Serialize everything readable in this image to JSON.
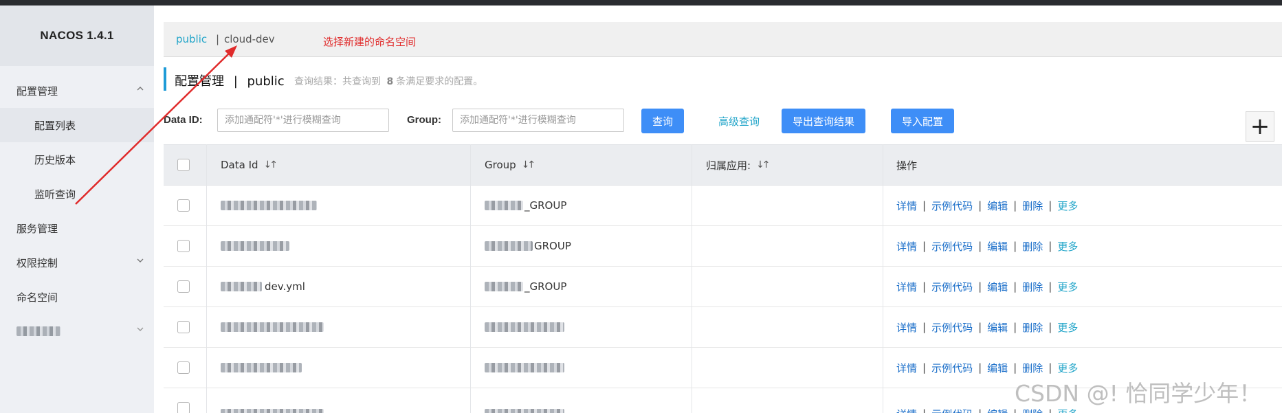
{
  "app": {
    "title": "NACOS 1.4.1"
  },
  "sidebar": {
    "items": [
      {
        "label": "配置管理",
        "chevron": "^"
      },
      {
        "label": "配置列表"
      },
      {
        "label": "历史版本"
      },
      {
        "label": "监听查询"
      },
      {
        "label": "服务管理"
      },
      {
        "label": "权限控制",
        "chevron": "v"
      },
      {
        "label": "命名空间"
      }
    ]
  },
  "namespace_bar": {
    "active": "public",
    "separator": "|",
    "other": "cloud-dev"
  },
  "annotation": {
    "text": "选择新建的命名空间",
    "color": "#e02b2b"
  },
  "page": {
    "title": "配置管理",
    "title_sep": "|",
    "namespace": "public",
    "result_prefix": "查询结果：共查询到",
    "result_count": "8",
    "result_suffix": "条满足要求的配置。"
  },
  "filters": {
    "dataid_label": "Data ID:",
    "dataid_placeholder": "添加通配符'*'进行模糊查询",
    "group_label": "Group:",
    "group_placeholder": "添加通配符'*'进行模糊查询",
    "query_button": "查询",
    "advanced_query": "高级查询",
    "export_button": "导出查询结果",
    "import_button": "导入配置",
    "add_button": "+"
  },
  "table": {
    "columns": {
      "data_id": "Data Id",
      "group": "Group",
      "app": "归属应用:",
      "ops": "操作",
      "sort_icon": "↓↑"
    },
    "rows": [
      {
        "group_suffix": "_GROUP"
      },
      {
        "group_suffix": "GROUP"
      },
      {
        "group_suffix": "_GROUP",
        "data_id_suffix": "dev.yml"
      },
      {
        "group_suffix": ""
      },
      {
        "group_suffix": ""
      },
      {
        "group_suffix": ""
      }
    ],
    "ops": {
      "detail": "详情",
      "sample": "示例代码",
      "edit": "编辑",
      "delete": "删除",
      "more": "更多",
      "sep": "|"
    }
  },
  "watermark": "CSDN @! 恰同学少年！",
  "colors": {
    "accent": "#3e8ef7",
    "link": "#22a5c9",
    "op_link": "#1a6ec9",
    "sidebar_bg": "#eef0f4"
  }
}
